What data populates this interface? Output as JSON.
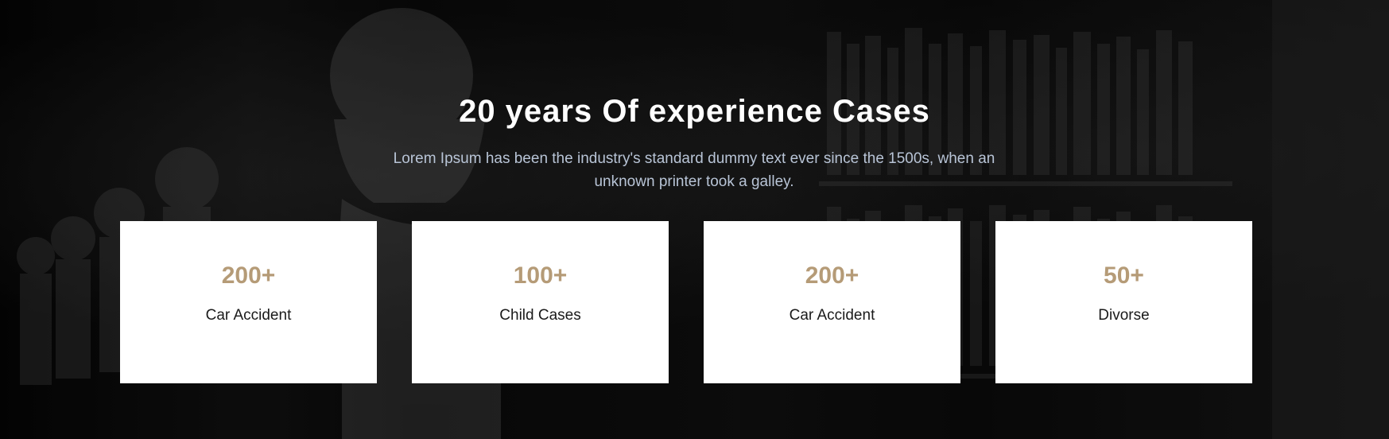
{
  "section": {
    "title": "20 years Of experience Cases",
    "subtitle": "Lorem Ipsum has been the industry's standard dummy text ever since the 1500s, when an unknown printer took a galley."
  },
  "stats": [
    {
      "value": "200+",
      "label": "Car Accident"
    },
    {
      "value": "100+",
      "label": "Child Cases"
    },
    {
      "value": "200+",
      "label": "Car Accident"
    },
    {
      "value": "50+",
      "label": "Divorse"
    }
  ],
  "colors": {
    "background": "#070707",
    "title": "#ffffff",
    "subtitle": "#b8c4d6",
    "card_background": "#ffffff",
    "stat_value": "#b59b77",
    "stat_label": "#1a1a1a"
  }
}
